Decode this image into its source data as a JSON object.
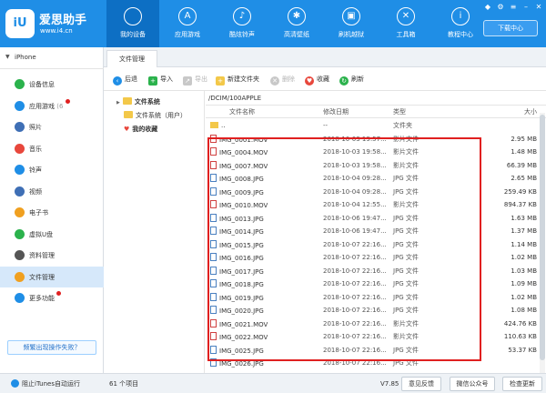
{
  "app": {
    "name": "爱思助手",
    "site": "www.i4.cn"
  },
  "nav": [
    {
      "label": "我的设备",
      "icon": "apple-icon",
      "glyph": "",
      "active": true
    },
    {
      "label": "应用游戏",
      "icon": "app-store-icon",
      "glyph": "A",
      "active": false
    },
    {
      "label": "酷炫铃声",
      "icon": "bell-icon",
      "glyph": "♪",
      "active": false
    },
    {
      "label": "高清壁纸",
      "icon": "snowflake-icon",
      "glyph": "✱",
      "active": false
    },
    {
      "label": "刷机越狱",
      "icon": "box-icon",
      "glyph": "▣",
      "active": false
    },
    {
      "label": "工具箱",
      "icon": "tools-icon",
      "glyph": "✕",
      "active": false
    },
    {
      "label": "教程中心",
      "icon": "info-icon",
      "glyph": "i",
      "active": false
    }
  ],
  "window": {
    "download_label": "下载中心"
  },
  "device": {
    "name": "iPhone"
  },
  "sidebar": {
    "items": [
      {
        "label": "设备信息",
        "icon": "device-info-icon",
        "color": "#2bb24c"
      },
      {
        "label": "应用游戏",
        "count": "(6",
        "icon": "apps-icon",
        "color": "#1f8ee6",
        "badge": true
      },
      {
        "label": "照片",
        "icon": "photo-icon",
        "color": "#3f6fb5"
      },
      {
        "label": "音乐",
        "icon": "music-icon",
        "color": "#e8473c"
      },
      {
        "label": "铃声",
        "icon": "ringtone-icon",
        "color": "#1f8ee6"
      },
      {
        "label": "视频",
        "icon": "video-icon",
        "color": "#3f6fb5"
      },
      {
        "label": "电子书",
        "icon": "ebook-icon",
        "color": "#f0a020"
      },
      {
        "label": "虚拟U盘",
        "icon": "usb-icon",
        "color": "#2bb24c"
      },
      {
        "label": "资料管理",
        "icon": "data-manage-icon",
        "color": "#555555"
      },
      {
        "label": "文件管理",
        "icon": "file-manage-icon",
        "color": "#f0a020",
        "active": true
      },
      {
        "label": "更多功能",
        "icon": "more-icon",
        "color": "#1f8ee6",
        "badge": true
      }
    ],
    "help_label": "频繁出现操作失败？"
  },
  "tab": {
    "label": "文件管理"
  },
  "toolbar": {
    "back": "后退",
    "import": "导入",
    "export": "导出",
    "new_folder": "新建文件夹",
    "delete": "删除",
    "favorite": "收藏",
    "refresh": "刷新"
  },
  "tree": {
    "root": "文件系统",
    "user": "文件系统（用户）",
    "favorites": "我的收藏"
  },
  "path": "/DCIM/100APPLE",
  "table": {
    "headers": {
      "name": "文件名称",
      "date": "修改日期",
      "type": "类型",
      "size": "大小"
    },
    "rows": [
      {
        "name": "..",
        "date": "--",
        "type": "文件夹",
        "size": "",
        "kind": "dir"
      },
      {
        "name": "IMG_0001.MOV",
        "date": "2018-10-03 19:57...",
        "type": "影片文件",
        "size": "2.95 MB",
        "kind": "mov"
      },
      {
        "name": "IMG_0004.MOV",
        "date": "2018-10-03 19:58...",
        "type": "影片文件",
        "size": "1.48 MB",
        "kind": "mov"
      },
      {
        "name": "IMG_0007.MOV",
        "date": "2018-10-03 19:58...",
        "type": "影片文件",
        "size": "66.39 MB",
        "kind": "mov"
      },
      {
        "name": "IMG_0008.JPG",
        "date": "2018-10-04 09:28...",
        "type": "JPG 文件",
        "size": "2.65 MB",
        "kind": "jpg"
      },
      {
        "name": "IMG_0009.JPG",
        "date": "2018-10-04 09:28...",
        "type": "JPG 文件",
        "size": "259.49 KB",
        "kind": "jpg"
      },
      {
        "name": "IMG_0010.MOV",
        "date": "2018-10-04 12:55...",
        "type": "影片文件",
        "size": "894.37 KB",
        "kind": "mov"
      },
      {
        "name": "IMG_0013.JPG",
        "date": "2018-10-06 19:47...",
        "type": "JPG 文件",
        "size": "1.63 MB",
        "kind": "jpg"
      },
      {
        "name": "IMG_0014.JPG",
        "date": "2018-10-06 19:47...",
        "type": "JPG 文件",
        "size": "1.37 MB",
        "kind": "jpg"
      },
      {
        "name": "IMG_0015.JPG",
        "date": "2018-10-07 22:16...",
        "type": "JPG 文件",
        "size": "1.14 MB",
        "kind": "jpg"
      },
      {
        "name": "IMG_0016.JPG",
        "date": "2018-10-07 22:16...",
        "type": "JPG 文件",
        "size": "1.02 MB",
        "kind": "jpg"
      },
      {
        "name": "IMG_0017.JPG",
        "date": "2018-10-07 22:16...",
        "type": "JPG 文件",
        "size": "1.03 MB",
        "kind": "jpg"
      },
      {
        "name": "IMG_0018.JPG",
        "date": "2018-10-07 22:16...",
        "type": "JPG 文件",
        "size": "1.09 MB",
        "kind": "jpg"
      },
      {
        "name": "IMG_0019.JPG",
        "date": "2018-10-07 22:16...",
        "type": "JPG 文件",
        "size": "1.02 MB",
        "kind": "jpg"
      },
      {
        "name": "IMG_0020.JPG",
        "date": "2018-10-07 22:16...",
        "type": "JPG 文件",
        "size": "1.08 MB",
        "kind": "jpg"
      },
      {
        "name": "IMG_0021.MOV",
        "date": "2018-10-07 22:16...",
        "type": "影片文件",
        "size": "424.76 KB",
        "kind": "mov"
      },
      {
        "name": "IMG_0022.MOV",
        "date": "2018-10-07 22:16...",
        "type": "影片文件",
        "size": "110.63 KB",
        "kind": "mov"
      },
      {
        "name": "IMG_0025.JPG",
        "date": "2018-10-07 22:16...",
        "type": "JPG 文件",
        "size": "53.37 KB",
        "kind": "jpg"
      },
      {
        "name": "IMG_0026.JPG",
        "date": "2018-10-07 22:16...",
        "type": "JPG 文件",
        "size": "",
        "kind": "jpg"
      }
    ]
  },
  "status": {
    "itunes": "阻止iTunes自动运行",
    "count": "61 个项目",
    "version": "V7.85",
    "feedback": "意见反馈",
    "wechat": "微信公众号",
    "update": "检查更新"
  },
  "colors": {
    "brand": "#1f8ee6",
    "highlight": "#e02020"
  }
}
